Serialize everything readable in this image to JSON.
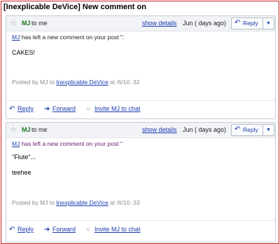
{
  "subject": "[Inexplicable DeVice] New comment on",
  "colors": {
    "frame_border": "#cc1f1f",
    "sender": "#1a7a21",
    "link": "#1a3bb0"
  },
  "messages": [
    {
      "sender": "MJ",
      "to": "to me",
      "show_details": "show details",
      "date": "Jun (    days ago)",
      "reply": "Reply",
      "more": "▼",
      "notice_name": "MJ",
      "notice_text": " has left a new comment on your post \":",
      "body": [
        "CAKES!"
      ],
      "posted_prefix": "Posted by MJ to ",
      "posted_blog": "Inexplicable DeVice",
      "posted_suffix": " at    /6/10     :32",
      "actions": {
        "reply": "Reply",
        "forward": "Forward",
        "invite": "Invite MJ to chat"
      }
    },
    {
      "sender": "MJ",
      "to": "to me",
      "show_details": "show details",
      "date": "Jun (    days ago)",
      "reply": "Reply",
      "more": "▼",
      "notice_name": "MJ",
      "notice_text": " has left a new comment on your post \"",
      "body": [
        "\"Flute\"...",
        "teehee"
      ],
      "posted_prefix": "Posted by MJ to ",
      "posted_blog": "Inexplicable DeVice",
      "posted_suffix": " at    /6/10     :33",
      "actions": {
        "reply": "Reply",
        "forward": "Forward",
        "invite": "Invite MJ to chat"
      }
    }
  ]
}
